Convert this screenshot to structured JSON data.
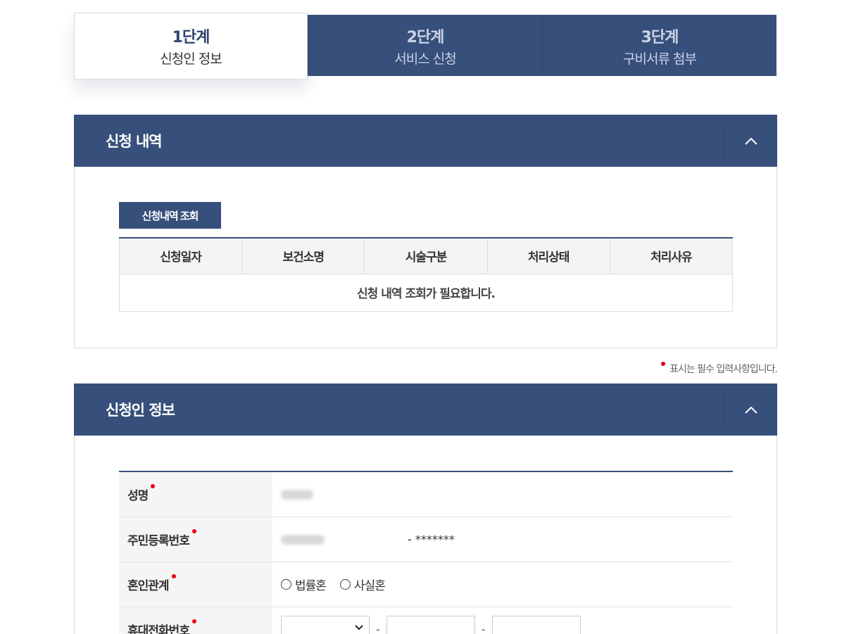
{
  "steps": [
    {
      "num": "1단계",
      "label": "신청인 정보",
      "active": true
    },
    {
      "num": "2단계",
      "label": "서비스 신청",
      "active": false
    },
    {
      "num": "3단계",
      "label": "구비서류 첨부",
      "active": false
    }
  ],
  "history_section": {
    "title": "신청 내역",
    "lookup_button": "신청내역 조회",
    "columns": [
      "신청일자",
      "보건소명",
      "시술구분",
      "처리상태",
      "처리사유"
    ],
    "empty_message": "신청 내역 조회가 필요합니다."
  },
  "required_note": "표시는 필수 입력사항입니다.",
  "applicant_section": {
    "title": "신청인 정보",
    "name_label": "성명",
    "rrn_label": "주민등록번호",
    "rrn_masked": "- *******",
    "marital_label": "혼인관계",
    "marital_options": [
      "법률혼",
      "사실혼"
    ],
    "phone_label": "휴대전화번호",
    "phone_separator": "-"
  },
  "colors": {
    "accent": "#374f7b",
    "required": "#e60012"
  },
  "icons": {
    "toggle": "chevron-up-icon",
    "select": "chevron-down-icon"
  }
}
